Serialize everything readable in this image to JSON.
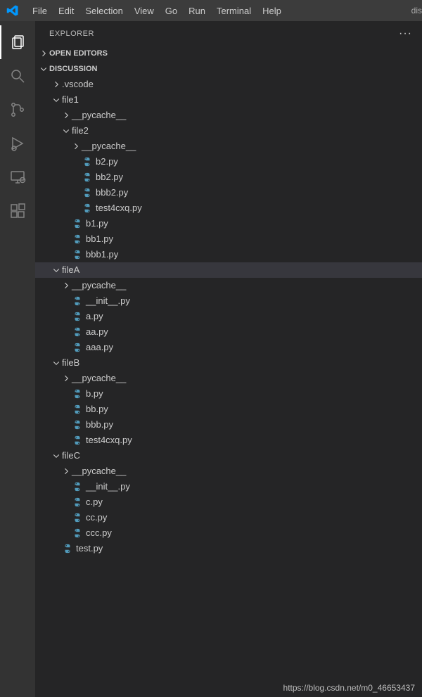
{
  "menubar": {
    "items": [
      "File",
      "Edit",
      "Selection",
      "View",
      "Go",
      "Run",
      "Terminal",
      "Help"
    ],
    "right_truncated": "dis"
  },
  "sidebar": {
    "title": "EXPLORER",
    "open_editors_label": "OPEN EDITORS",
    "workspace_label": "DISCUSSION"
  },
  "tree": [
    {
      "type": "folder",
      "label": ".vscode",
      "expanded": false,
      "depth": 1,
      "selected": false
    },
    {
      "type": "folder",
      "label": "file1",
      "expanded": true,
      "depth": 1,
      "selected": false
    },
    {
      "type": "folder",
      "label": "__pycache__",
      "expanded": false,
      "depth": 2,
      "selected": false
    },
    {
      "type": "folder",
      "label": "file2",
      "expanded": true,
      "depth": 2,
      "selected": false
    },
    {
      "type": "folder",
      "label": "__pycache__",
      "expanded": false,
      "depth": 3,
      "selected": false
    },
    {
      "type": "pyfile",
      "label": "b2.py",
      "depth": 3,
      "selected": false
    },
    {
      "type": "pyfile",
      "label": "bb2.py",
      "depth": 3,
      "selected": false
    },
    {
      "type": "pyfile",
      "label": "bbb2.py",
      "depth": 3,
      "selected": false
    },
    {
      "type": "pyfile",
      "label": "test4cxq.py",
      "depth": 3,
      "selected": false
    },
    {
      "type": "pyfile",
      "label": "b1.py",
      "depth": 2,
      "selected": false
    },
    {
      "type": "pyfile",
      "label": "bb1.py",
      "depth": 2,
      "selected": false
    },
    {
      "type": "pyfile",
      "label": "bbb1.py",
      "depth": 2,
      "selected": false
    },
    {
      "type": "folder",
      "label": "fileA",
      "expanded": true,
      "depth": 1,
      "selected": true
    },
    {
      "type": "folder",
      "label": "__pycache__",
      "expanded": false,
      "depth": 2,
      "selected": false
    },
    {
      "type": "pyfile",
      "label": "__init__.py",
      "depth": 2,
      "selected": false
    },
    {
      "type": "pyfile",
      "label": "a.py",
      "depth": 2,
      "selected": false
    },
    {
      "type": "pyfile",
      "label": "aa.py",
      "depth": 2,
      "selected": false
    },
    {
      "type": "pyfile",
      "label": "aaa.py",
      "depth": 2,
      "selected": false
    },
    {
      "type": "folder",
      "label": "fileB",
      "expanded": true,
      "depth": 1,
      "selected": false
    },
    {
      "type": "folder",
      "label": "__pycache__",
      "expanded": false,
      "depth": 2,
      "selected": false
    },
    {
      "type": "pyfile",
      "label": "b.py",
      "depth": 2,
      "selected": false
    },
    {
      "type": "pyfile",
      "label": "bb.py",
      "depth": 2,
      "selected": false
    },
    {
      "type": "pyfile",
      "label": "bbb.py",
      "depth": 2,
      "selected": false
    },
    {
      "type": "pyfile",
      "label": "test4cxq.py",
      "depth": 2,
      "selected": false
    },
    {
      "type": "folder",
      "label": "fileC",
      "expanded": true,
      "depth": 1,
      "selected": false
    },
    {
      "type": "folder",
      "label": "__pycache__",
      "expanded": false,
      "depth": 2,
      "selected": false
    },
    {
      "type": "pyfile",
      "label": "__init__.py",
      "depth": 2,
      "selected": false
    },
    {
      "type": "pyfile",
      "label": "c.py",
      "depth": 2,
      "selected": false
    },
    {
      "type": "pyfile",
      "label": "cc.py",
      "depth": 2,
      "selected": false
    },
    {
      "type": "pyfile",
      "label": "ccc.py",
      "depth": 2,
      "selected": false
    },
    {
      "type": "pyfile",
      "label": "test.py",
      "depth": 1,
      "selected": false
    }
  ],
  "watermark": "https://blog.csdn.net/m0_46653437"
}
